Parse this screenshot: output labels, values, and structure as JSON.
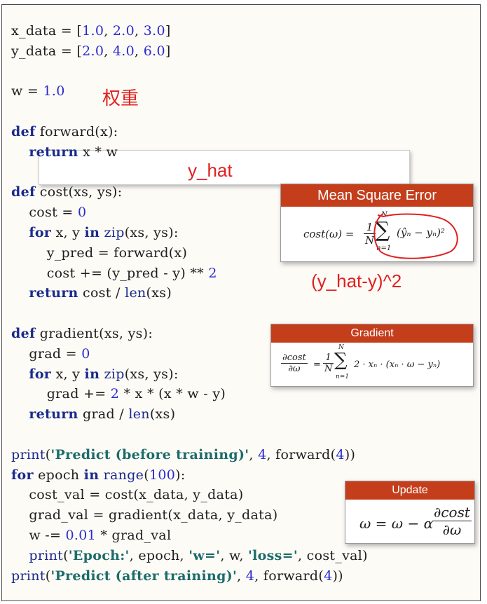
{
  "annotations": {
    "weight_label": "权重",
    "y_hat_label": "y_hat",
    "y_hat_minus_y_sq": "(y_hat-y)^2"
  },
  "formula_boxes": {
    "mse": {
      "title": "Mean Square Error",
      "formula_lhs": "cost(ω) =",
      "frac_num": "1",
      "frac_den": "N",
      "sum_top": "N",
      "sum_bottom": "n=1",
      "term": "(ŷₙ − yₙ)²"
    },
    "gradient": {
      "title": "Gradient",
      "lhs_num": "∂cost",
      "lhs_den": "∂ω",
      "frac_num": "1",
      "frac_den": "N",
      "sum_top": "N",
      "sum_bottom": "n=1",
      "term": "2 · xₙ · (xₙ · ω − yₙ)"
    },
    "update": {
      "title": "Update",
      "lhs": "ω = ω − α",
      "frac_num": "∂cost",
      "frac_den": "∂ω"
    }
  },
  "colors": {
    "header_bg": "#c43e1c",
    "annotation": "#e02020",
    "keyword": "#1a2a8c",
    "number": "#2a2ad0",
    "string": "#1d6b6b"
  }
}
